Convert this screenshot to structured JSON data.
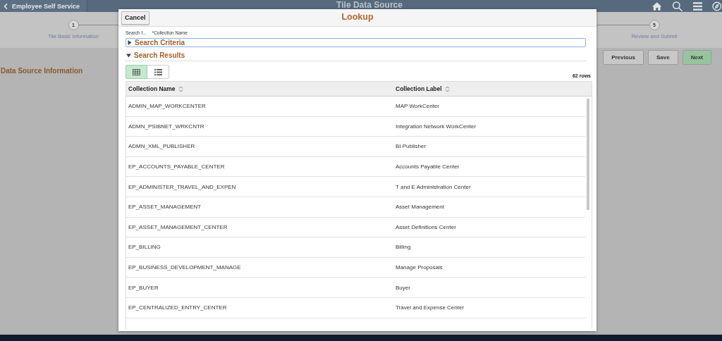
{
  "header": {
    "back_label": "Employee Self Service",
    "title": "Tile Data Source"
  },
  "steps": [
    {
      "number": "1",
      "label": "Tile Basic Information"
    },
    {
      "number": "5",
      "label": "Review and Submit"
    }
  ],
  "nav_buttons": [
    {
      "label": "Previous",
      "kind": "normal"
    },
    {
      "label": "Save",
      "kind": "normal"
    },
    {
      "label": "Next",
      "kind": "primary"
    }
  ],
  "section_title": "Data Source Information",
  "lookup": {
    "cancel": "Cancel",
    "title": "Lookup",
    "search_for": "Search f...",
    "field_label": "*Collection Name",
    "search_criteria": {
      "label": "Search Criteria",
      "expanded": false
    },
    "search_results": {
      "label": "Search Results",
      "expanded": true
    },
    "view_toggle": [
      {
        "kind": "grid",
        "selected": true
      },
      {
        "kind": "list",
        "selected": false
      }
    ],
    "row_count": "62 rows",
    "columns": [
      "Collection Name",
      "Collection Label"
    ],
    "rows": [
      [
        "ADMIN_MAP_WORKCENTER",
        "MAP WorkCenter"
      ],
      [
        "ADMN_PSIBNET_WRKCNTR",
        "Integration Network WorkCenter"
      ],
      [
        "ADMN_XML_PUBLISHER",
        "BI Publisher"
      ],
      [
        "EP_ACCOUNTS_PAYABLE_CENTER",
        "Accounts Payable Center"
      ],
      [
        "EP_ADMINISTER_TRAVEL_AND_EXPEN",
        "T and E Administration Center"
      ],
      [
        "EP_ASSET_MANAGEMENT",
        "Asset Management"
      ],
      [
        "EP_ASSET_MANAGEMENT_CENTER",
        "Asset Definitions Center"
      ],
      [
        "EP_BILLING",
        "Billing"
      ],
      [
        "EP_BUSINESS_DEVELOPMENT_MANAGE",
        "Manage Proposals"
      ],
      [
        "EP_BUYER",
        "Buyer"
      ],
      [
        "EP_CENTRALIZED_ENTRY_CENTER",
        "Travel and Expense Center"
      ]
    ]
  }
}
